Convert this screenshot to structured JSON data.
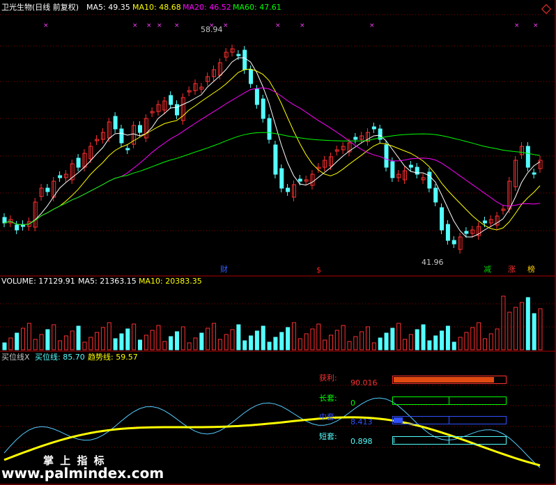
{
  "title_bar": {
    "security": "卫光生物(日线 前复权)",
    "ma5": "MA5: 49.35",
    "ma10": "MA10: 48.68",
    "ma20": "MA20: 46.52",
    "ma60": "MA60: 47.61"
  },
  "price_panel": {
    "high_label": "58.94",
    "low_label": "41.96",
    "event_marks": [
      {
        "text": "财",
        "color": "#3060ff"
      },
      {
        "text": "$",
        "color": "#ff2020"
      },
      {
        "text": "减",
        "color": "#00d000"
      },
      {
        "text": "涨",
        "color": "#ff3030"
      },
      {
        "text": "榜",
        "color": "#ffd000"
      }
    ]
  },
  "volume_panel": {
    "volume": "VOLUME: 17129.91",
    "ma5": "MA5: 21363.15",
    "ma10": "MA10: 20383.35"
  },
  "indicator_panel": {
    "name": "买位线X",
    "buy_line": "买位线: 85.70",
    "trend_line": "趋势线: 59.57",
    "stats": [
      {
        "label": "获利:",
        "value": "90.016",
        "color": "#ff3030",
        "fill": 0.9
      },
      {
        "label": "长套:",
        "value": "0",
        "color": "#00ff00",
        "fill": 0
      },
      {
        "label": "中套:",
        "value": "8.413",
        "color": "#3050ff",
        "fill": 0.084
      },
      {
        "label": "短套:",
        "value": "0.898",
        "color": "#55ffff",
        "fill": 0.009
      }
    ]
  },
  "watermark": {
    "brand": "掌 上 指 标",
    "url": "www.palmindex.com"
  },
  "colors": {
    "up": "#ff3030",
    "down": "#55ffff",
    "ma5": "#ffffff",
    "ma10": "#ffff00",
    "ma20": "#ff00ff",
    "ma60": "#00ff00",
    "grid": "#8b0000"
  }
}
